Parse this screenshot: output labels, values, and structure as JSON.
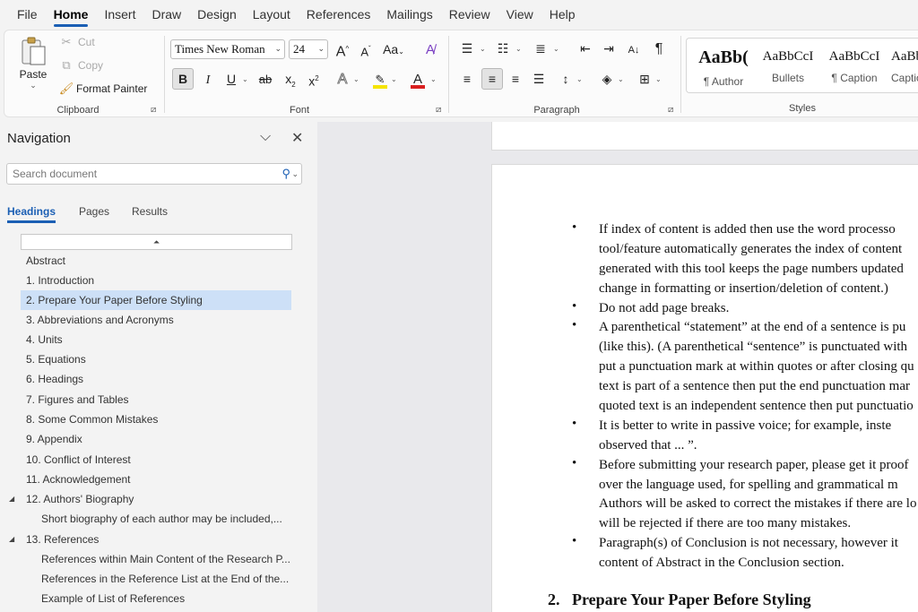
{
  "menu": {
    "tabs": [
      "File",
      "Home",
      "Insert",
      "Draw",
      "Design",
      "Layout",
      "References",
      "Mailings",
      "Review",
      "View",
      "Help"
    ],
    "active": "Home"
  },
  "ribbon": {
    "clipboard": {
      "paste": "Paste",
      "cut": "Cut",
      "copy": "Copy",
      "format_painter": "Format Painter",
      "label": "Clipboard"
    },
    "font": {
      "font_name": "Times New Roman",
      "font_size": "24",
      "grow": "A",
      "shrink": "A",
      "change_case": "Aa",
      "bold": "B",
      "italic": "I",
      "underline": "U",
      "strikethrough": "ab",
      "subscript": "x",
      "superscript": "x",
      "text_effects": "A",
      "highlight": "✎",
      "font_color": "A",
      "label": "Font"
    },
    "paragraph": {
      "label": "Paragraph"
    },
    "styles": {
      "items": [
        {
          "sample": "AaBb(",
          "name": "¶ Author"
        },
        {
          "sample": "AaBbCcI",
          "name": "Bullets"
        },
        {
          "sample": "AaBbCcI",
          "name": "¶ Caption"
        },
        {
          "sample": "AaBb",
          "name": "Captio"
        }
      ],
      "label": "Styles"
    }
  },
  "navigation": {
    "title": "Navigation",
    "search_placeholder": "Search document",
    "tabs": [
      "Headings",
      "Pages",
      "Results"
    ],
    "active_tab": "Headings",
    "headings": [
      "Abstract",
      "1. Introduction",
      "2. Prepare Your Paper Before Styling",
      "3. Abbreviations and Acronyms",
      "4. Units",
      "5. Equations",
      "6. Headings",
      "7. Figures and Tables",
      "8. Some Common Mistakes",
      "9. Appendix",
      "10. Conflict of Interest",
      "11. Acknowledgement",
      "12. Authors' Biography",
      "Short biography of each author may be included,...",
      "13. References",
      "References within Main Content of the Research P...",
      "References in the Reference List at the End of the...",
      "Example of List of References"
    ],
    "selected_index": 2
  },
  "document": {
    "bullets": [
      [
        "If index of content is added then use the word processo",
        "tool/feature automatically generates the index of content",
        "generated with this tool keeps the page numbers updated",
        "change in formatting or insertion/deletion of content.)"
      ],
      [
        "Do not add page breaks."
      ],
      [
        "A parenthetical “statement” at the end of a sentence is pu",
        "(like this). (A parenthetical “sentence” is punctuated with",
        "put a punctuation mark at within quotes or after closing qu",
        "text is part of a sentence then put the end punctuation mar",
        "quoted text is an independent sentence then put punctuatio"
      ],
      [
        "It is better to write in passive voice; for example, inste",
        "observed that ... ”."
      ],
      [
        "Before submitting your research paper, please get it proof",
        "over the language used, for spelling and grammatical m",
        "Authors will be asked to correct the mistakes if there are lo",
        "will be rejected if there are too many mistakes."
      ],
      [
        "Paragraph(s) of Conclusion is not necessary, however it",
        "content of Abstract in the Conclusion section."
      ]
    ],
    "heading_number": "2.",
    "heading_text": "Prepare Your Paper Before Styling"
  },
  "colors": {
    "accent": "#1b5fb4",
    "highlight": "#f5e400",
    "font_color": "#d92020",
    "selection": "#cde0f7"
  }
}
